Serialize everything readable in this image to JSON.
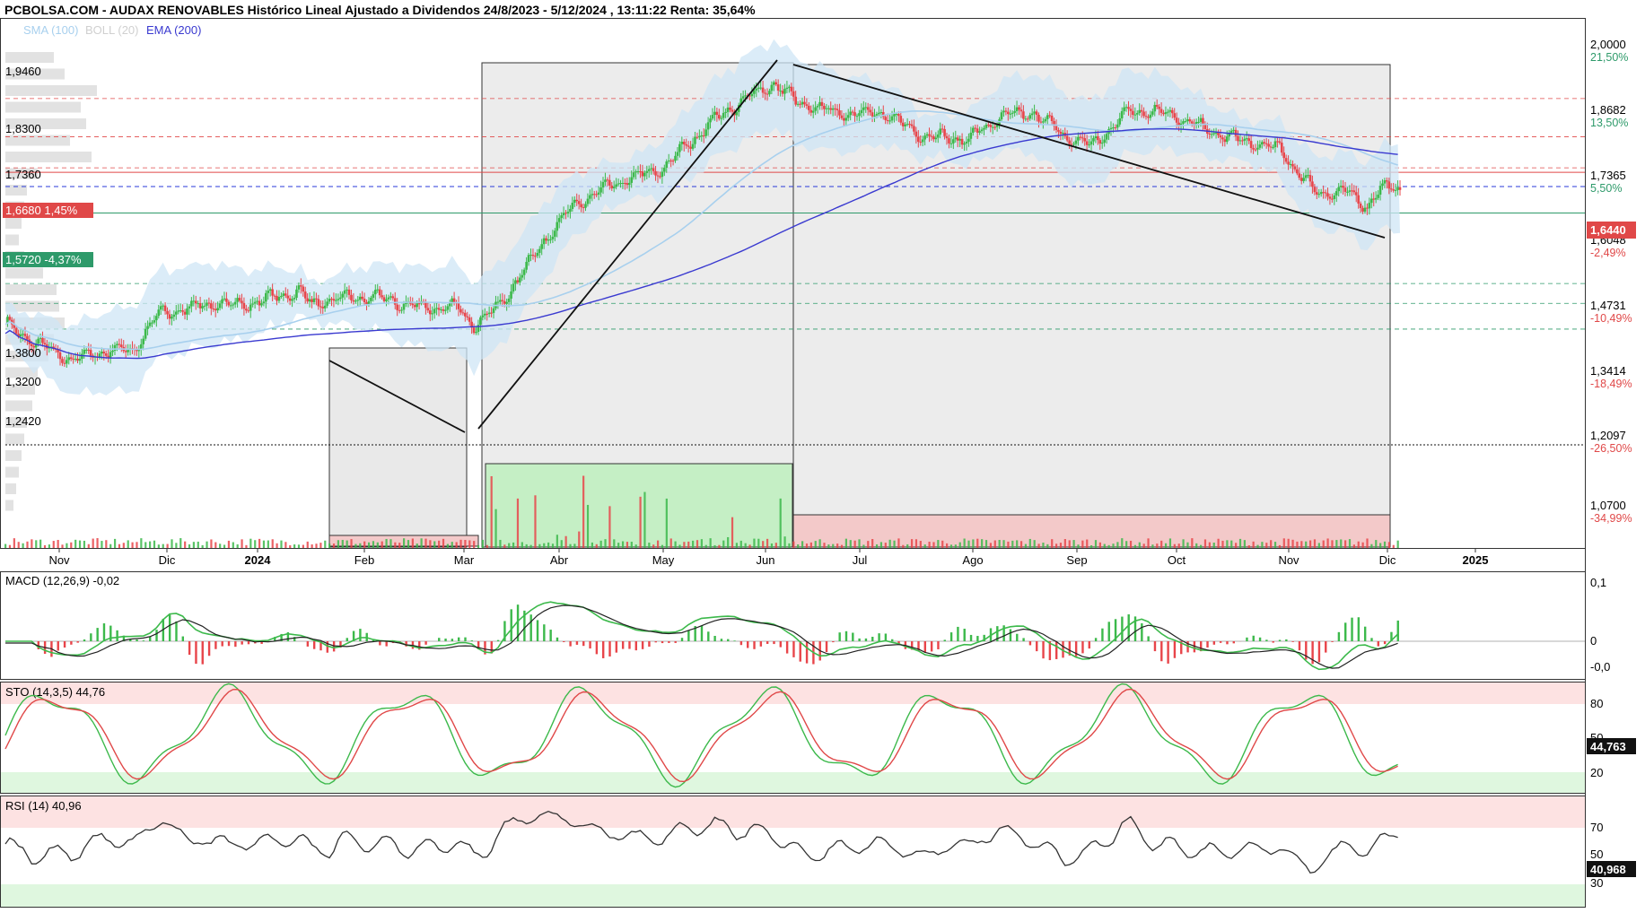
{
  "header": {
    "title": "PCBOLSA.COM - AUDAX RENOVABLES Histórico Lineal Ajustado a Dividendos 24/8/2023 - 5/12/2024 , 13:11:22 Renta: 35,64%",
    "legend_sma": "SMA (100)",
    "legend_boll": "BOLL (20)",
    "legend_ema": "EMA (200)"
  },
  "colors": {
    "up": "#3cb94b",
    "down": "#e8454a",
    "sma": "#a8d0ee",
    "boll_fill": "#cfe6f6",
    "ema": "#3a3ad0",
    "resistance": "#e04848",
    "support": "#2e9a6a",
    "trend": "#111111",
    "pct_green": "#2e9a6a",
    "pct_red": "#e04848"
  },
  "chart_data": [
    {
      "type": "candlestick",
      "name": "AUDAX RENOVABLES",
      "x_labels": [
        "Nov",
        "Dic",
        "2024",
        "Feb",
        "Mar",
        "Abr",
        "May",
        "Jun",
        "Jul",
        "Ago",
        "Sep",
        "Oct",
        "Nov",
        "Dic",
        "2025"
      ],
      "right_axis": [
        {
          "value": "2,0000",
          "pct": "21,50%",
          "pct_color": "green"
        },
        {
          "value": "1,8682",
          "pct": "13,50%",
          "pct_color": "green"
        },
        {
          "value": "1,7365",
          "pct": "5,50%",
          "pct_color": "green"
        },
        {
          "value": "1,6048",
          "pct": "-2,49%",
          "pct_color": "red"
        },
        {
          "value": "1,4731",
          "pct": "-10,49%",
          "pct_color": "red"
        },
        {
          "value": "1,3414",
          "pct": "-18,49%",
          "pct_color": "red"
        },
        {
          "value": "1,2097",
          "pct": "-26,50%",
          "pct_color": "red"
        },
        {
          "value": "1,0700",
          "pct": "-34,99%",
          "pct_color": "red"
        }
      ],
      "left_levels": [
        "1,9460",
        "1,8300",
        "1,7360",
        "1,3800",
        "1,3200",
        "1,2420"
      ],
      "resistance_box": {
        "value": "1,6680",
        "pct": "1,45%"
      },
      "support_box": {
        "value": "1,5720",
        "pct": "-4,37%"
      },
      "last_price": "1,6440",
      "ylim": [
        1.03,
        2.02
      ],
      "series": [
        {
          "name": "SMA (100)"
        },
        {
          "name": "BOLL (20)"
        },
        {
          "name": "EMA (200)"
        }
      ]
    },
    {
      "type": "line",
      "name": "MACD (12,26,9)",
      "current": "-0,02",
      "axis": [
        "0,1",
        "0",
        "-0,0"
      ]
    },
    {
      "type": "line",
      "name": "STO (14,3,5)",
      "current": "44,76",
      "last_label": "44,763",
      "axis": [
        "80",
        "20"
      ],
      "hidden_tick": "50"
    },
    {
      "type": "line",
      "name": "RSI (14)",
      "current": "40,96",
      "last_label": "40,968",
      "axis": [
        "70",
        "50",
        "30"
      ]
    }
  ]
}
